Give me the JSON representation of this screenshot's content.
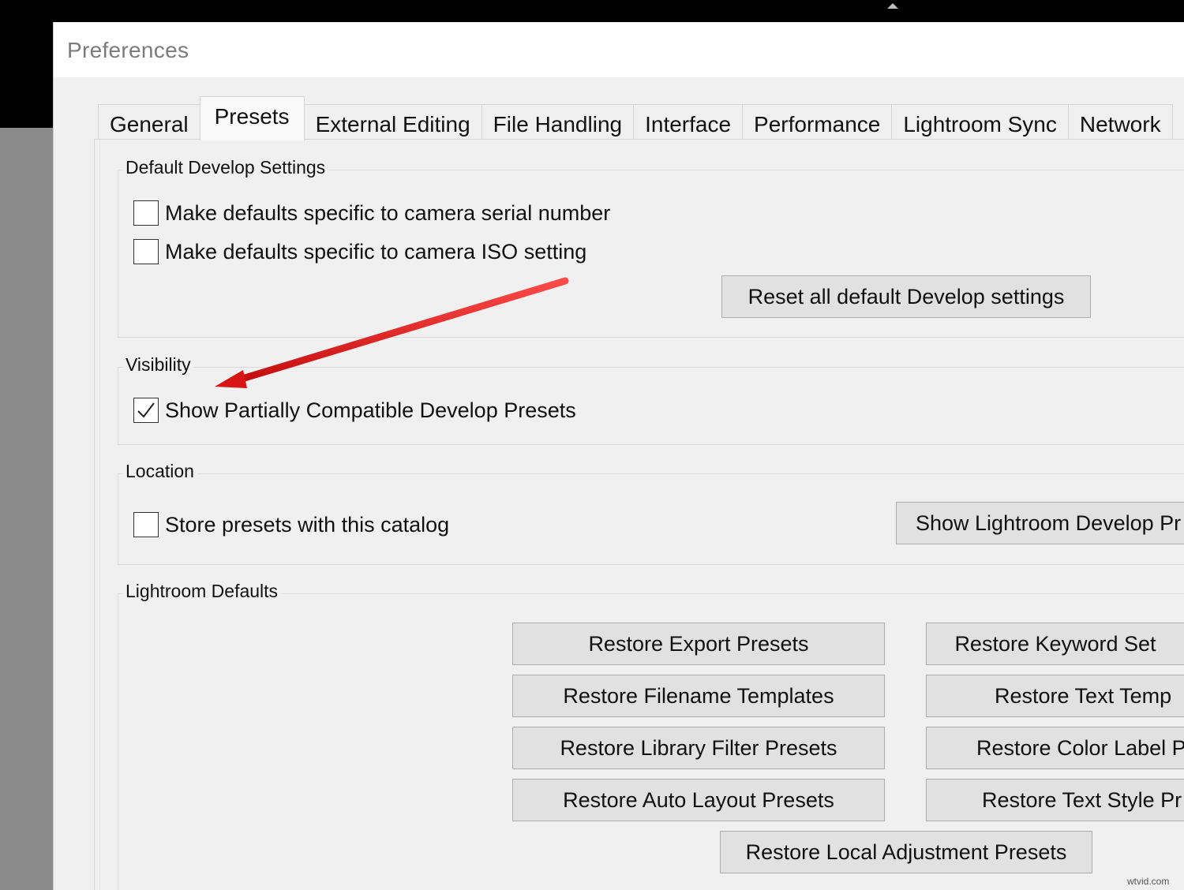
{
  "window": {
    "title": "Preferences"
  },
  "tabs": [
    {
      "label": "General",
      "active": false
    },
    {
      "label": "Presets",
      "active": true
    },
    {
      "label": "External Editing",
      "active": false
    },
    {
      "label": "File Handling",
      "active": false
    },
    {
      "label": "Interface",
      "active": false
    },
    {
      "label": "Performance",
      "active": false
    },
    {
      "label": "Lightroom Sync",
      "active": false
    },
    {
      "label": "Network",
      "active": false
    }
  ],
  "default_develop": {
    "title": "Default Develop Settings",
    "serial_checkbox": {
      "label": "Make defaults specific to camera serial number",
      "checked": false
    },
    "iso_checkbox": {
      "label": "Make defaults specific to camera ISO setting",
      "checked": false
    },
    "reset_button": "Reset all default Develop settings"
  },
  "visibility": {
    "title": "Visibility",
    "partial_checkbox": {
      "label": "Show Partially Compatible Develop Presets",
      "checked": true
    }
  },
  "location": {
    "title": "Location",
    "store_checkbox": {
      "label": "Store presets with this catalog",
      "checked": false
    },
    "show_button": "Show Lightroom Develop Pr"
  },
  "lightroom_defaults": {
    "title": "Lightroom Defaults",
    "buttons": {
      "export": "Restore Export Presets",
      "keyword": "Restore Keyword Set",
      "filename": "Restore Filename Templates",
      "text_templates": "Restore Text Temp",
      "library_filter": "Restore Library Filter Presets",
      "color_label": "Restore Color Label P",
      "auto_layout": "Restore Auto Layout Presets",
      "text_style": "Restore Text Style Pr",
      "local_adjustment": "Restore Local Adjustment Presets"
    }
  },
  "annotation_colors": {
    "arrow": "#e01818"
  },
  "watermark": "wtvid.com"
}
